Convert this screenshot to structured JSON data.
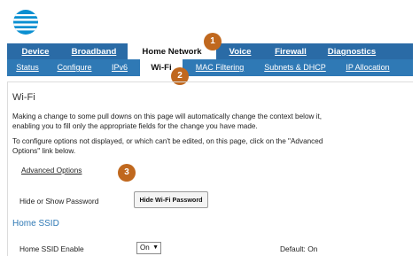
{
  "nav": {
    "main": [
      "Device",
      "Broadband",
      "Home Network",
      "Voice",
      "Firewall",
      "Diagnostics"
    ],
    "sub": [
      "Status",
      "Configure",
      "IPv6",
      "Wi-Fi",
      "MAC Filtering",
      "Subnets & DHCP",
      "IP Allocation"
    ]
  },
  "badges": [
    "1",
    "2",
    "3"
  ],
  "page": {
    "title": "Wi-Fi",
    "para1_line1": "Making a change to some pull downs on this page will automatically change the context below it,",
    "para1_line2": "enabling you to fill only the appropriate fields for the change you have made.",
    "para2_line1": "To configure options not displayed, or which can't be edited, on this page, click on the \"Advanced",
    "para2_line2": "Options\" link below.",
    "advanced_link": "Advanced Options",
    "hide_show_label": "Hide or Show Password",
    "hide_pw_button": "Hide Wi-Fi Password",
    "home_ssid_heading": "Home SSID",
    "ssid_enable_label": "Home SSID Enable",
    "ssid_enable_value": "On",
    "default_text": "Default: On"
  },
  "colors": {
    "nav_main_bg": "#2a6ba6",
    "nav_sub_bg": "#2f79b5",
    "badge": "#c0681e",
    "logo": "#0a8fd1"
  },
  "icons": {
    "logo": "att-globe-logo",
    "select_arrow": "chevron-down-icon"
  }
}
